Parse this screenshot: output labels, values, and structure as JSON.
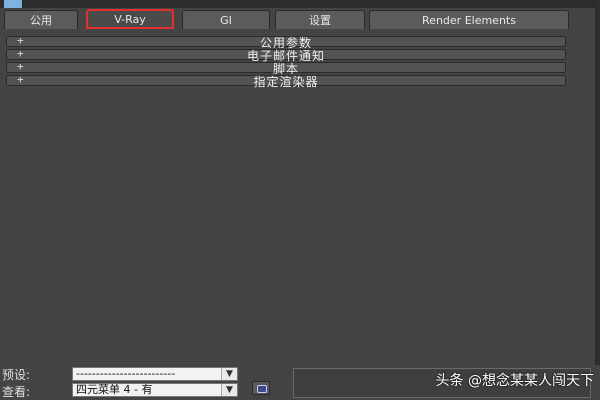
{
  "tabs": [
    {
      "label": "公用"
    },
    {
      "label": "V-Ray"
    },
    {
      "label": "GI"
    },
    {
      "label": "设置"
    },
    {
      "label": "Render Elements"
    }
  ],
  "active_tab": "V-Ray",
  "rollouts": [
    {
      "expand_symbol": "+",
      "label": "公用参数"
    },
    {
      "expand_symbol": "+",
      "label": "电子邮件通知"
    },
    {
      "expand_symbol": "+",
      "label": "脚本"
    },
    {
      "expand_symbol": "+",
      "label": "指定渲染器"
    }
  ],
  "bottom": {
    "preset_label": "预设:",
    "preset_value": "-------------------------",
    "view_label": "查看:",
    "view_value": "四元菜单 4 - 有"
  },
  "watermark": "头条 @想念某某人闯天下",
  "colors": {
    "active_tab_border": "#e03030",
    "panel_bg": "#444444"
  }
}
